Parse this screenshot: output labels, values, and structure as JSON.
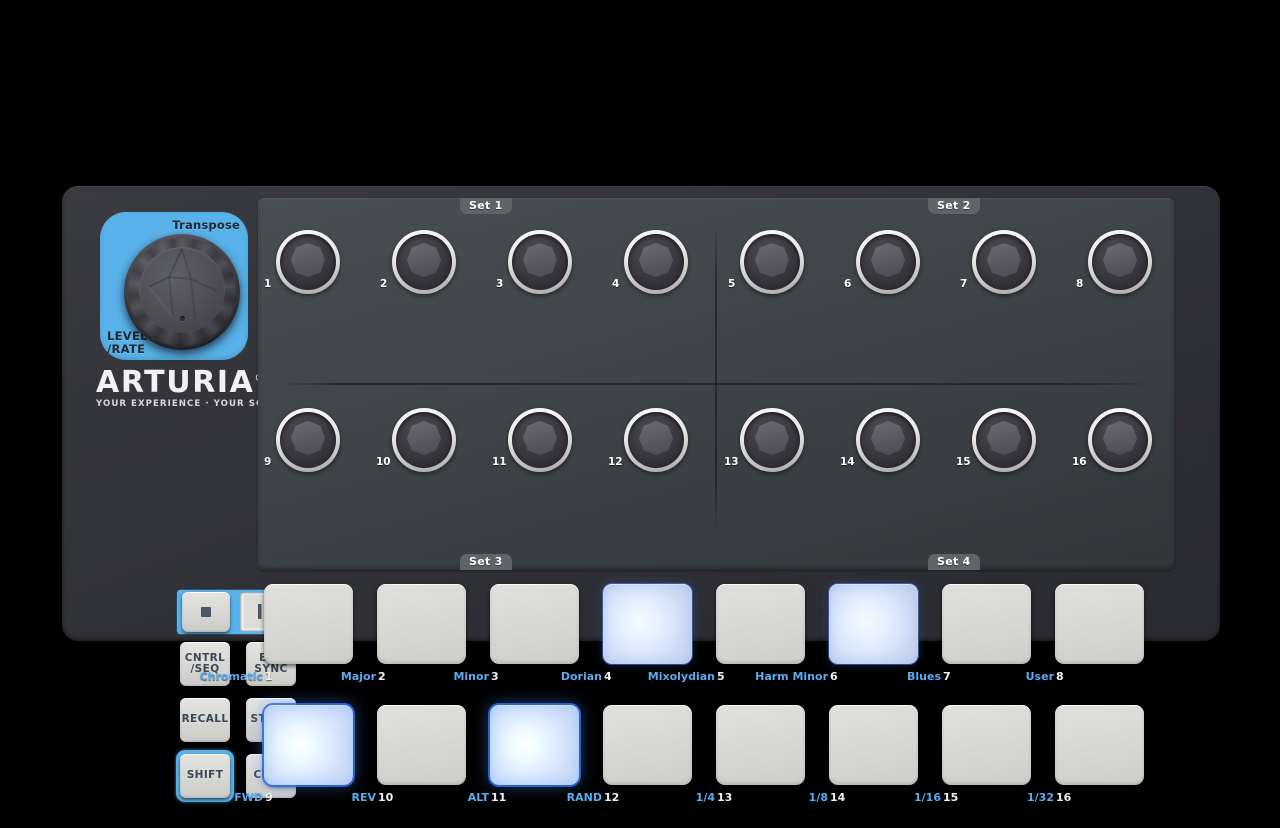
{
  "device": {
    "brand": "ARTURIA",
    "brand_reg": "®",
    "tagline": "YOUR EXPERIENCE · YOUR SOUND",
    "accent_color": "#58b1e8",
    "chassis_color": "#34343b",
    "background_color": "#000000",
    "panel_color": "#3f4549",
    "pad_label_color": "#5aabf0"
  },
  "transpose": {
    "top_label": "Transpose",
    "bottom_label_line1": "LEVEL",
    "bottom_label_line2": "/RATE"
  },
  "transport": {
    "stop": {
      "name": "stop-button",
      "icon": "stop-square-icon"
    },
    "play": {
      "name": "play-button",
      "icon": "play-triangle-icon"
    }
  },
  "control_buttons": [
    {
      "name": "cntrl-seq-button",
      "line1": "CNTRL",
      "line2": "/SEQ",
      "highlighted": false
    },
    {
      "name": "ext-sync-button",
      "line1": "EXT",
      "line2": "SYNC",
      "highlighted": false
    },
    {
      "name": "recall-button",
      "line1": "RECALL",
      "line2": "",
      "highlighted": false
    },
    {
      "name": "store-button",
      "line1": "STORE",
      "line2": "",
      "highlighted": false
    },
    {
      "name": "shift-button",
      "line1": "SHIFT",
      "line2": "",
      "highlighted": true
    },
    {
      "name": "chan-button",
      "line1": "CHAN",
      "line2": "",
      "highlighted": false
    }
  ],
  "knob_panel": {
    "set_labels": [
      "Set 1",
      "Set 2",
      "Set 3",
      "Set 4"
    ],
    "knobs_row1": [
      "1",
      "2",
      "3",
      "4",
      "5",
      "6",
      "7",
      "8"
    ],
    "knobs_row2": [
      "9",
      "10",
      "11",
      "12",
      "13",
      "14",
      "15",
      "16"
    ]
  },
  "pads": {
    "row1": [
      {
        "num": "1",
        "fn": "Chromatic",
        "state": "off"
      },
      {
        "num": "2",
        "fn": "Major",
        "state": "off"
      },
      {
        "num": "3",
        "fn": "Minor",
        "state": "off"
      },
      {
        "num": "4",
        "fn": "Dorian",
        "state": "lit-soft"
      },
      {
        "num": "5",
        "fn": "Mixolydian",
        "state": "off"
      },
      {
        "num": "6",
        "fn": "Harm Minor",
        "state": "lit-soft"
      },
      {
        "num": "7",
        "fn": "Blues",
        "state": "off"
      },
      {
        "num": "8",
        "fn": "User",
        "state": "off"
      }
    ],
    "row2": [
      {
        "num": "9",
        "fn": "FWD",
        "state": "lit-bright"
      },
      {
        "num": "10",
        "fn": "REV",
        "state": "off"
      },
      {
        "num": "11",
        "fn": "ALT",
        "state": "lit-bright"
      },
      {
        "num": "12",
        "fn": "RAND",
        "state": "off"
      },
      {
        "num": "13",
        "fn": "1/4",
        "state": "off"
      },
      {
        "num": "14",
        "fn": "1/8",
        "state": "off"
      },
      {
        "num": "15",
        "fn": "1/16",
        "state": "off"
      },
      {
        "num": "16",
        "fn": "1/32",
        "state": "off"
      }
    ]
  }
}
